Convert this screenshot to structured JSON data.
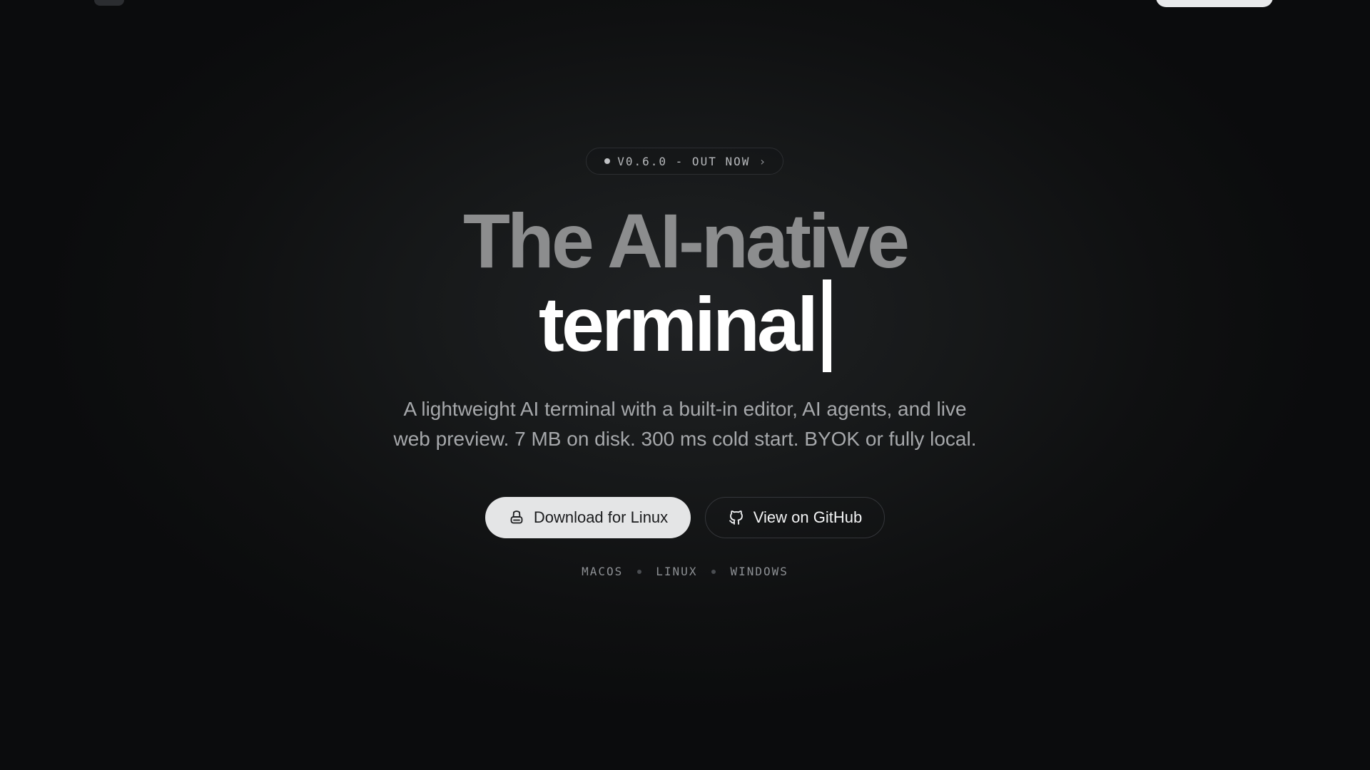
{
  "release_pill": {
    "label": "V0.6.0 - OUT NOW",
    "chevron": "›"
  },
  "headline": {
    "line1": "The AI-native",
    "line2": "terminal"
  },
  "subtitle": {
    "line1": "A lightweight AI terminal with a built-in editor, AI agents, and live",
    "line2": "web preview. 7 MB on disk. 300 ms cold start. BYOK or fully local."
  },
  "buttons": {
    "download_label": "Download for Linux",
    "download_icon": "linux-tux-icon",
    "github_label": "View on GitHub",
    "github_icon": "github-icon"
  },
  "platforms": [
    "MACOS",
    "LINUX",
    "WINDOWS"
  ],
  "colors": {
    "background": "#0c0d0e",
    "headline_muted": "#8c8d8e",
    "headline_bright": "#ffffff",
    "primary_button": "#e4e5e6"
  }
}
